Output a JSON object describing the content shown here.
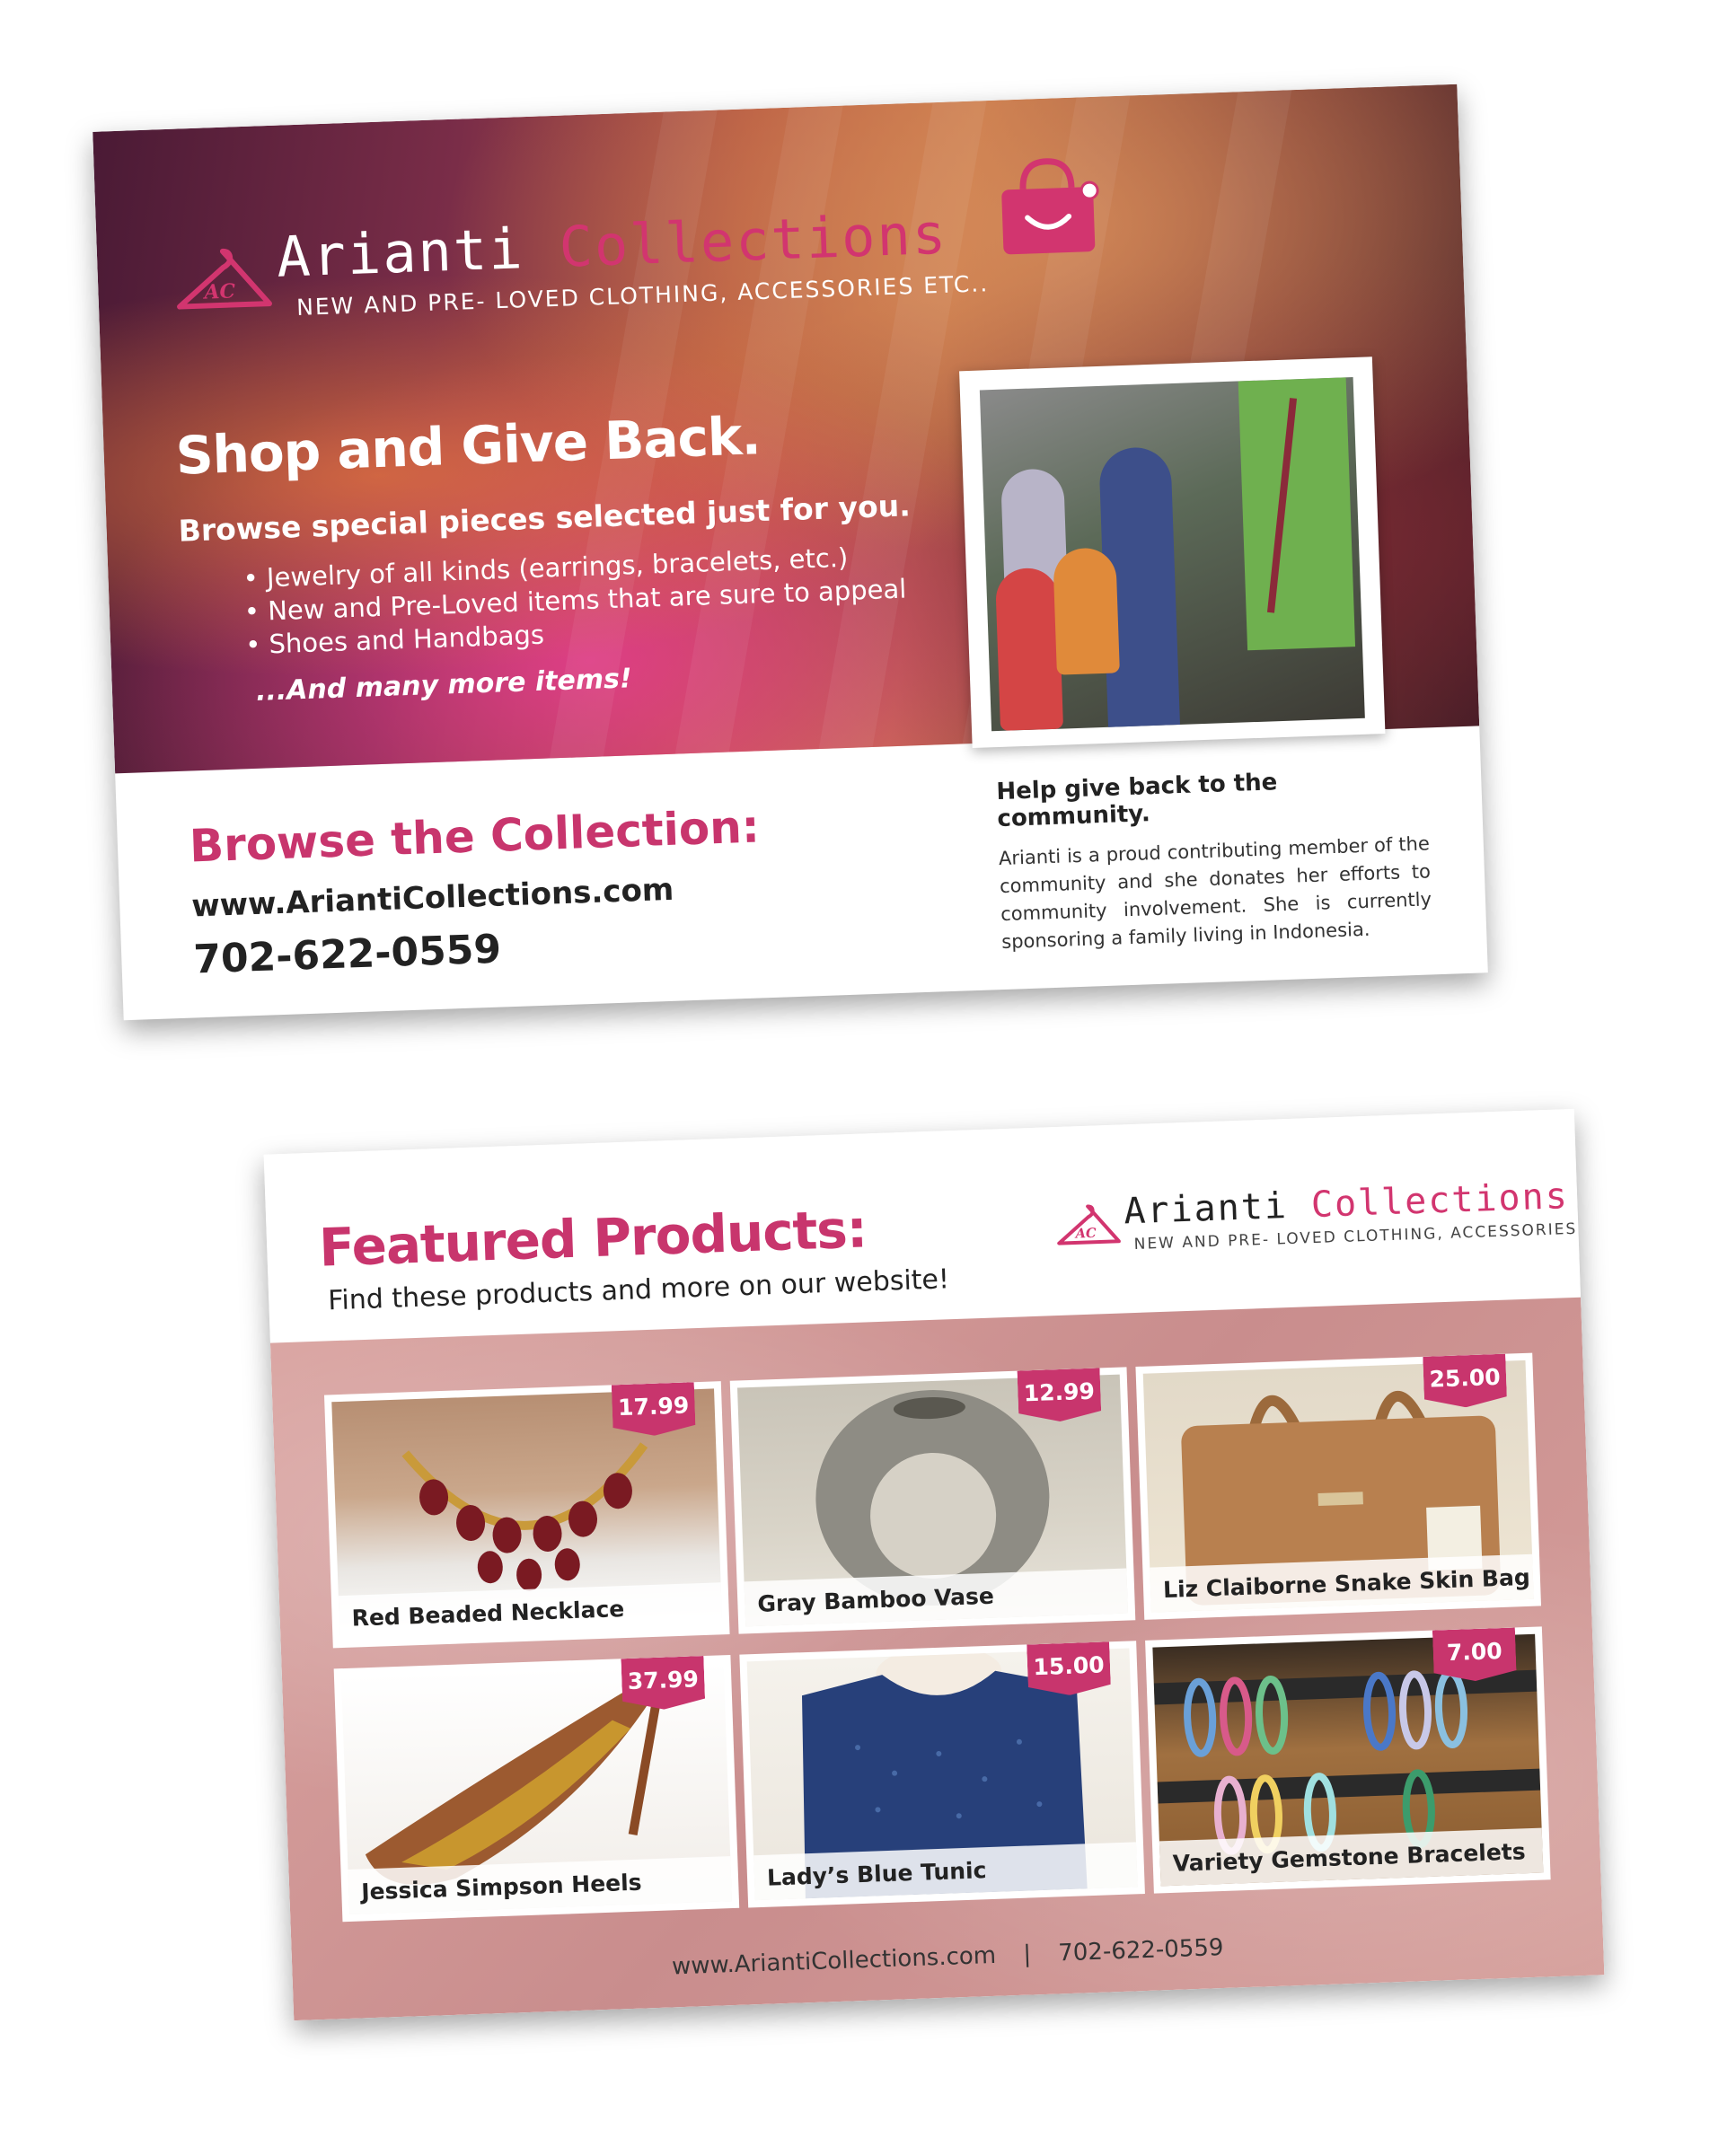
{
  "brand": {
    "name_part1": "Arianti",
    "name_part2": "Collections",
    "monogram": "AC",
    "tagline": "NEW AND PRE- LOVED CLOTHING, ACCESSORIES ETC..",
    "accent_color": "#c8356d"
  },
  "front": {
    "heading": "Shop and Give Back.",
    "subheading": "Browse special pieces selected just for you.",
    "bullets": [
      "Jewelry of all kinds (earrings, bracelets, etc.)",
      "New and Pre-Loved items that are sure to appeal",
      "Shoes and Handbags"
    ],
    "more": "...And many more items!",
    "browse_title": "Browse the Collection:",
    "url": "www.AriantiCollections.com",
    "phone": "702-622-0559",
    "give_title": "Help give back to the community.",
    "give_body": "Arianti is a proud contributing member of the community and she donates her efforts to community involvement. She is currently sponsoring a family living in Indonesia."
  },
  "back": {
    "title": "Featured Products:",
    "subtitle": "Find these products and more on our website!",
    "products": [
      {
        "name": "Red Beaded Necklace",
        "price": "17.99"
      },
      {
        "name": "Gray Bamboo Vase",
        "price": "12.99"
      },
      {
        "name": "Liz Claiborne Snake Skin Bag",
        "price": "25.00"
      },
      {
        "name": "Jessica Simpson Heels",
        "price": "37.99"
      },
      {
        "name": "Lady’s Blue Tunic",
        "price": "15.00"
      },
      {
        "name": "Variety Gemstone Bracelets",
        "price": "7.00"
      }
    ],
    "footer_url": "www.AriantiCollections.com",
    "footer_sep": "|",
    "footer_phone": "702-622-0559"
  }
}
